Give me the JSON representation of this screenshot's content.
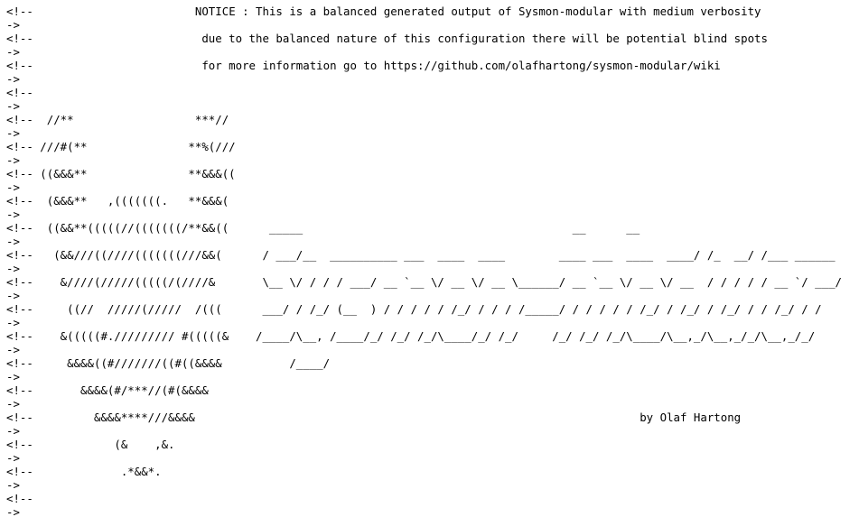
{
  "comment_open": "<!--",
  "comment_close": "->",
  "notice": [
    "NOTICE : This is a balanced generated output of Sysmon-modular with medium verbosity",
    "due to the balanced nature of this configuration there will be potential blind spots",
    "for more information go to https://github.com/olafhartong/sysmon-modular/wiki"
  ],
  "banner_lines": [
    "  //**                  ***//",
    " ///#(**               **%(///",
    " ((&&&**               **&&&((",
    "  (&&&**   ,(((((((.   **&&&(",
    "  ((&&**(((((//(((((((/**&&((      _____                                        __      __",
    "   (&&///((////(((((((///&&(      / ___/__  __________ ___  ____  ____        ____ ___  ____  ____/ /_  __/ /___ ______",
    "    &////(/////(((((/(////&       \\__ \\/ / / / ___/ __ `__ \\/ __ \\/ __ \\______/ __ `__ \\/ __ \\/ __  / / / / / __ `/ ___/",
    "     ((//  /////(/////  /(((      ___/ / /_/ (__  ) / / / / / /_/ / / / /_____/ / / / / / /_/ / /_/ / /_/ / / /_/ / /",
    "    &(((((#.///////// #(((((&    /____/\\__, /____/_/ /_/ /_/\\____/_/ /_/     /_/ /_/ /_/\\____/\\__,_/\\__,_/_/\\__,_/_/",
    "     &&&&((#///////((#((&&&&          /____/",
    "       &&&&(#/***//(#(&&&&",
    "         &&&&****///&&&&                                                                  by Olaf Hartong",
    "            (&    ,&.",
    "             .*&&*."
  ]
}
